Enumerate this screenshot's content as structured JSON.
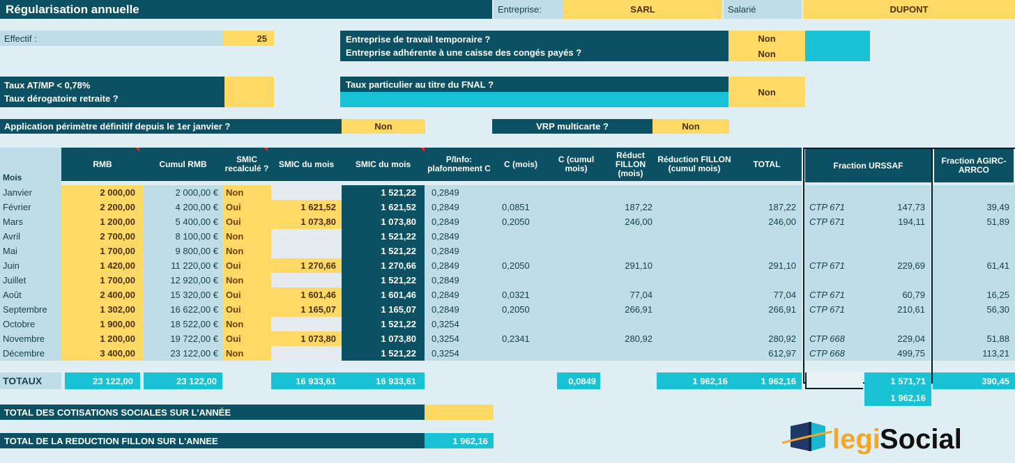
{
  "header": {
    "title": "Régularisation annuelle",
    "entreprise_label": "Entreprise:",
    "entreprise_value": "SARL",
    "salarie_label": "Salarié",
    "salarie_value": "DUPONT"
  },
  "params": {
    "effectif_label": "Effectif :",
    "effectif_value": "25",
    "ett_line1": "Entreprise de travail temporaire ?",
    "ett_line2": "Entreprise adhérente à une caisse des congés payés ?",
    "ett_answer1": "Non",
    "ett_answer2": "Non",
    "atmp_line1": "Taux AT/MP < 0,78%",
    "atmp_line2": "Taux dérogatoire retraite ?",
    "atmp_value": "",
    "fnal_label": "Taux particulier au titre du FNAL ?",
    "fnal_answer": "Non",
    "perimetre_label": "Application périmètre définitif depuis le 1er janvier ?",
    "perimetre_answer": "Non",
    "vrp_label": "VRP multicarte ?",
    "vrp_answer": "Non"
  },
  "table": {
    "columns": {
      "mois": "Mois",
      "rmb": "RMB",
      "cumul_rmb": "Cumul RMB",
      "smic_recalcule": "SMIC recalculé ?",
      "smic_du_mois_r": "SMIC du mois",
      "smic_du_mois": "SMIC du mois",
      "pinfo": "P/Info: plafonnement C",
      "c_mois": "C (mois)",
      "c_cumul": "C (cumul mois)",
      "reduct_fillon_mois": "Réduct FILLON (mois)",
      "reduction_fillon_cumul": "Réduction FILLON (cumul mois)",
      "total": "TOTAL",
      "fraction_urssaf": "Fraction URSSAF",
      "fraction_agirc": "Fraction AGIRC-ARRCO"
    },
    "rows": [
      {
        "mois": "Janvier",
        "rmb": "2 000,00",
        "cumul": "2 000,00 €",
        "recalcule": "Non",
        "smic_recalc": "",
        "smic_mois": "1 521,22",
        "pinfo": "0,2849",
        "c_mois": "",
        "c_cumul": "",
        "rfm": "",
        "rfc": "",
        "total": "",
        "ctp": "",
        "urssaf": "",
        "agirc": ""
      },
      {
        "mois": "Février",
        "rmb": "2 200,00",
        "cumul": "4 200,00 €",
        "recalcule": "Oui",
        "smic_recalc": "1 621,52",
        "smic_mois": "1 621,52",
        "pinfo": "0,2849",
        "c_mois": "0,0851",
        "c_cumul": "",
        "rfm": "187,22",
        "rfc": "",
        "total": "187,22",
        "ctp": "CTP 671",
        "urssaf": "147,73",
        "agirc": "39,49"
      },
      {
        "mois": "Mars",
        "rmb": "1 200,00",
        "cumul": "5 400,00 €",
        "recalcule": "Oui",
        "smic_recalc": "1 073,80",
        "smic_mois": "1 073,80",
        "pinfo": "0,2849",
        "c_mois": "0,2050",
        "c_cumul": "",
        "rfm": "246,00",
        "rfc": "",
        "total": "246,00",
        "ctp": "CTP 671",
        "urssaf": "194,11",
        "agirc": "51,89"
      },
      {
        "mois": "Avril",
        "rmb": "2 700,00",
        "cumul": "8 100,00 €",
        "recalcule": "Non",
        "smic_recalc": "",
        "smic_mois": "1 521,22",
        "pinfo": "0,2849",
        "c_mois": "",
        "c_cumul": "",
        "rfm": "",
        "rfc": "",
        "total": "",
        "ctp": "",
        "urssaf": "",
        "agirc": ""
      },
      {
        "mois": "Mai",
        "rmb": "1 700,00",
        "cumul": "9 800,00 €",
        "recalcule": "Non",
        "smic_recalc": "",
        "smic_mois": "1 521,22",
        "pinfo": "0,2849",
        "c_mois": "",
        "c_cumul": "",
        "rfm": "",
        "rfc": "",
        "total": "",
        "ctp": "",
        "urssaf": "",
        "agirc": ""
      },
      {
        "mois": "Juin",
        "rmb": "1 420,00",
        "cumul": "11 220,00 €",
        "recalcule": "Oui",
        "smic_recalc": "1 270,66",
        "smic_mois": "1 270,66",
        "pinfo": "0,2849",
        "c_mois": "0,2050",
        "c_cumul": "",
        "rfm": "291,10",
        "rfc": "",
        "total": "291,10",
        "ctp": "CTP 671",
        "urssaf": "229,69",
        "agirc": "61,41"
      },
      {
        "mois": "Juillet",
        "rmb": "1 700,00",
        "cumul": "12 920,00 €",
        "recalcule": "Non",
        "smic_recalc": "",
        "smic_mois": "1 521,22",
        "pinfo": "0,2849",
        "c_mois": "",
        "c_cumul": "",
        "rfm": "",
        "rfc": "",
        "total": "",
        "ctp": "",
        "urssaf": "",
        "agirc": ""
      },
      {
        "mois": "Août",
        "rmb": "2 400,00",
        "cumul": "15 320,00 €",
        "recalcule": "Oui",
        "smic_recalc": "1 601,46",
        "smic_mois": "1 601,46",
        "pinfo": "0,2849",
        "c_mois": "0,0321",
        "c_cumul": "",
        "rfm": "77,04",
        "rfc": "",
        "total": "77,04",
        "ctp": "CTP 671",
        "urssaf": "60,79",
        "agirc": "16,25"
      },
      {
        "mois": "Septembre",
        "rmb": "1 302,00",
        "cumul": "16 622,00 €",
        "recalcule": "Oui",
        "smic_recalc": "1 165,07",
        "smic_mois": "1 165,07",
        "pinfo": "0,2849",
        "c_mois": "0,2050",
        "c_cumul": "",
        "rfm": "266,91",
        "rfc": "",
        "total": "266,91",
        "ctp": "CTP 671",
        "urssaf": "210,61",
        "agirc": "56,30"
      },
      {
        "mois": "Octobre",
        "rmb": "1 900,00",
        "cumul": "18 522,00 €",
        "recalcule": "Non",
        "smic_recalc": "",
        "smic_mois": "1 521,22",
        "pinfo": "0,3254",
        "c_mois": "",
        "c_cumul": "",
        "rfm": "",
        "rfc": "",
        "total": "",
        "ctp": "",
        "urssaf": "",
        "agirc": ""
      },
      {
        "mois": "Novembre",
        "rmb": "1 200,00",
        "cumul": "19 722,00 €",
        "recalcule": "Oui",
        "smic_recalc": "1 073,80",
        "smic_mois": "1 073,80",
        "pinfo": "0,3254",
        "c_mois": "0,2341",
        "c_cumul": "",
        "rfm": "280,92",
        "rfc": "",
        "total": "280,92",
        "ctp": "CTP 668",
        "urssaf": "229,04",
        "agirc": "51,88"
      },
      {
        "mois": "Décembre",
        "rmb": "3 400,00",
        "cumul": "23 122,00 €",
        "recalcule": "Non",
        "smic_recalc": "",
        "smic_mois": "1 521,22",
        "pinfo": "0,3254",
        "c_mois": "",
        "c_cumul": "",
        "rfm": "",
        "rfc": "",
        "total": "612,97",
        "ctp": "CTP 668",
        "urssaf": "499,75",
        "agirc": "113,21"
      }
    ],
    "totaux": {
      "label": "TOTAUX",
      "rmb": "23 122,00",
      "cumul": "23 122,00",
      "smic_recalc": "16 933,61",
      "smic_mois": "16 933,61",
      "c_cumul": "0,0849",
      "rfc": "1 962,16",
      "total": "1 962,16",
      "urssaf": "1 571,71",
      "agirc": "390,45",
      "urssaf_sub": "1 962,16"
    }
  },
  "bottom": {
    "cotisations_label": "TOTAL DES COTISATIONS SOCIALES SUR L'ANNÉE",
    "cotisations_value": "",
    "fillon_label": "TOTAL DE LA REDUCTION FILLON SUR L'ANNEE",
    "fillon_value": "1 962,16"
  },
  "logo": {
    "text_a": "legi",
    "text_b": "Social"
  },
  "colors": {
    "dark_teal": "#0b5163",
    "cyan": "#18c1d4",
    "gold": "#ffd966",
    "light_blue": "#bfdde6",
    "page_bg": "#dfeef2"
  }
}
